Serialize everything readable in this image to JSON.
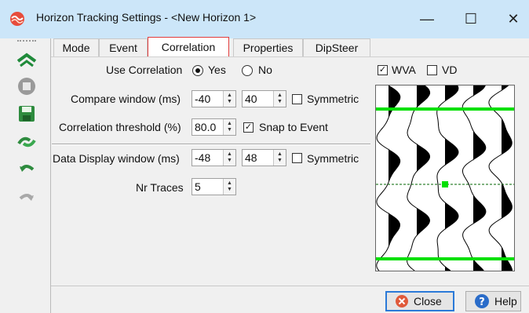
{
  "window": {
    "title": "Horizon Tracking Settings - <New Horizon 1>",
    "minimize_glyph": "—",
    "maximize_glyph": "☐",
    "close_glyph": "✕"
  },
  "toolbar": {
    "icons": [
      "track-icon",
      "stop-icon",
      "save-icon",
      "undo-redo-icon",
      "undo-icon",
      "redo-icon"
    ]
  },
  "tabs": [
    {
      "label": "Mode",
      "active": false
    },
    {
      "label": "Event",
      "active": false
    },
    {
      "label": "Correlation",
      "active": true
    },
    {
      "label": "Properties",
      "active": false
    },
    {
      "label": "DipSteer",
      "active": false
    }
  ],
  "correlation": {
    "use_label": "Use Correlation",
    "yes_label": "Yes",
    "no_label": "No",
    "use_value": "Yes",
    "compare_label": "Compare window (ms)",
    "compare_start": "-40",
    "compare_end": "40",
    "compare_symmetric_label": "Symmetric",
    "compare_symmetric_checked": false,
    "threshold_label": "Correlation threshold (%)",
    "threshold_value": "80.0",
    "snap_label": "Snap to Event",
    "snap_checked": true,
    "display_label": "Data Display window (ms)",
    "display_start": "-48",
    "display_end": "48",
    "display_symmetric_label": "Symmetric",
    "display_symmetric_checked": false,
    "nrtraces_label": "Nr Traces",
    "nrtraces_value": "5"
  },
  "display": {
    "wva_label": "WVA",
    "wva_checked": true,
    "vd_label": "VD",
    "vd_checked": false
  },
  "buttons": {
    "close_label": "Close",
    "help_label": "Help"
  },
  "colors": {
    "titlebar": "#cce6f9",
    "horizon_line": "#00e000",
    "active_tab_border": "#e23b3b",
    "default_button_border": "#2b7ad8"
  }
}
